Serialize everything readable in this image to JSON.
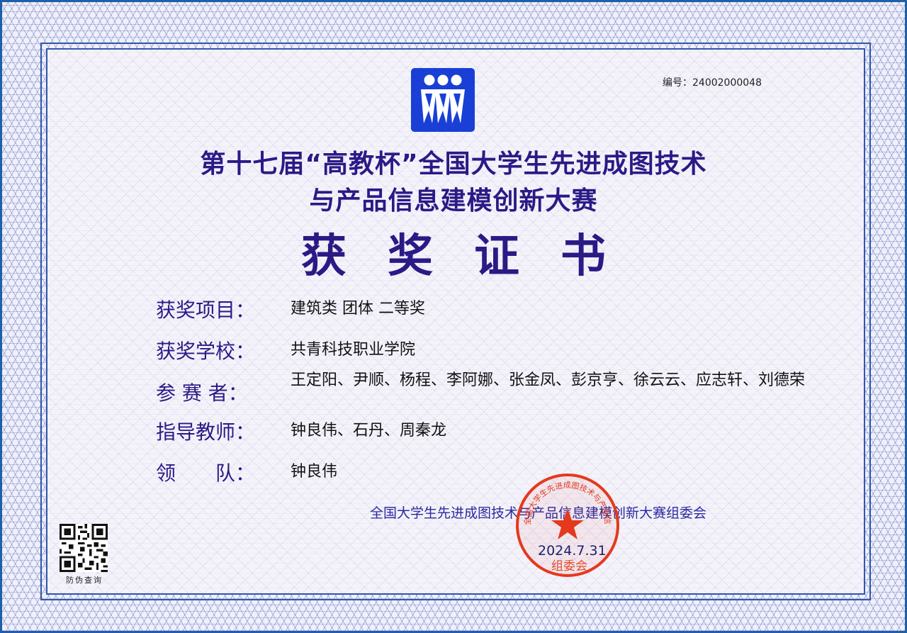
{
  "certificate": {
    "serial_label": "编号：24002000048",
    "title_line1": "第十七届“高教杯”全国大学生先进成图技术",
    "title_line2": "与产品信息建模创新大赛",
    "heading": "获奖证书",
    "fields": [
      {
        "label": "获奖项目：",
        "value": "建筑类 团体 二等奖"
      },
      {
        "label": "获奖学校：",
        "value": "共青科技职业学院"
      },
      {
        "label": "参 赛 者：",
        "value": "王定阳、尹顺、杨程、李阿娜、张金凤、彭京亨、徐云云、应志轩、刘德荣"
      },
      {
        "label": "指导教师：",
        "value": "钟良伟、石丹、周秦龙"
      },
      {
        "label": "领　　队：",
        "value": "钟良伟"
      }
    ],
    "organizer": "全国大学生先进成图技术与产品信息建模创新大赛组委会",
    "date": "2024.7.31",
    "seal_bottom_text": "组委会",
    "seal_ring_text": "全国大学生先进成图技术与产品信息建模创新大赛",
    "qr_label": "防伪查询"
  },
  "colors": {
    "title": "#2a1a86",
    "border": "#1f5fa8",
    "logo": "#1a3fd6",
    "seal": "#e4391c"
  },
  "icons": {
    "logo": "three-figures-logo-icon",
    "seal": "official-red-seal",
    "qr": "qr-code-icon"
  }
}
